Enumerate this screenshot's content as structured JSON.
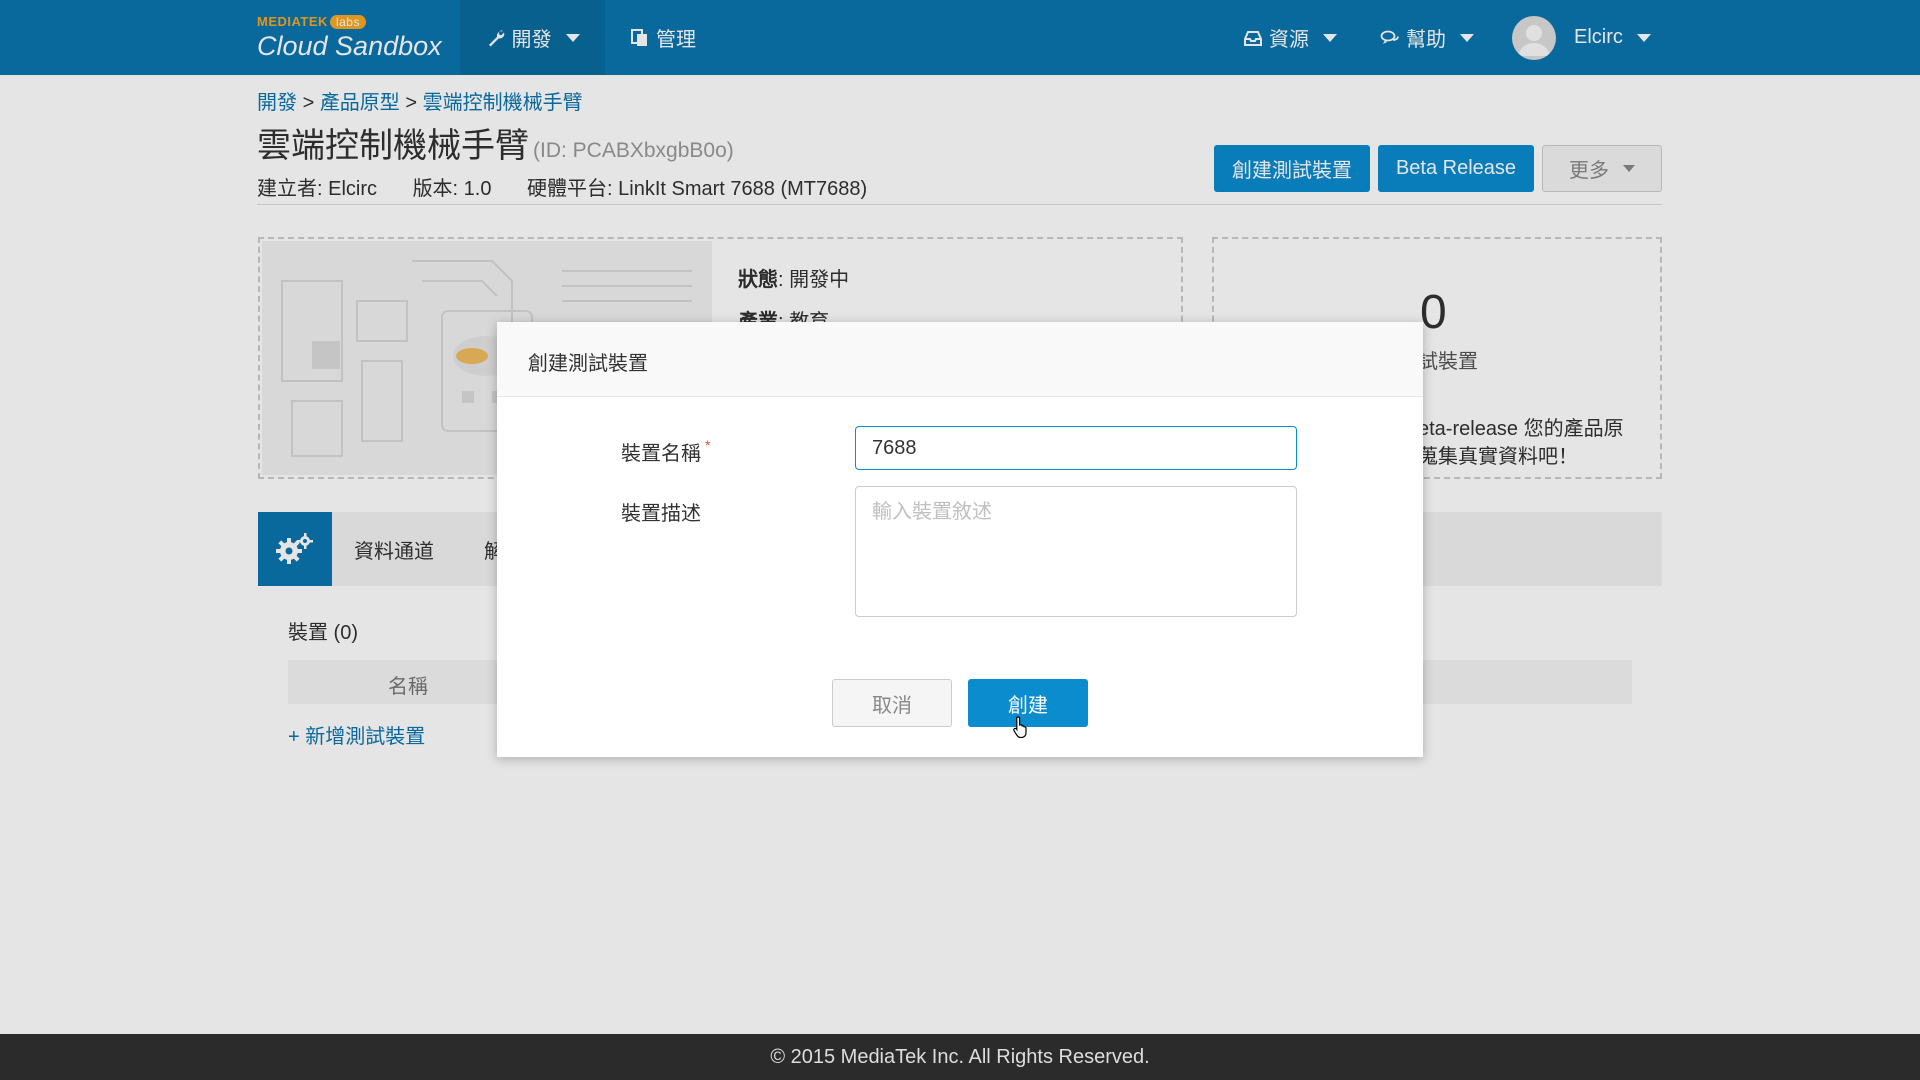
{
  "navbar": {
    "logo_brand": "MEDIATEK",
    "logo_labs": "labs",
    "logo_name": "Cloud Sandbox",
    "dev_label": "開發",
    "manage_label": "管理",
    "resources_label": "資源",
    "help_label": "幫助",
    "user_name": "Elcirc"
  },
  "breadcrumb": {
    "item1": "開發",
    "sep": ">",
    "item2": "產品原型",
    "item3": "雲端控制機械手臂"
  },
  "project": {
    "title": "雲端控制機械手臂",
    "id_text": "(ID: PCABXbxgbB0o)",
    "creator": "建立者: Elcirc",
    "version": "版本: 1.0",
    "platform": "硬體平台: LinkIt Smart 7688 (MT7688)"
  },
  "actions": {
    "create_test_device": "創建測試裝置",
    "beta_release": "Beta Release",
    "more": "更多"
  },
  "info": {
    "status_key": "狀態",
    "status_value": ": 開發中",
    "industry_key": "產業",
    "industry_value": ": 教育"
  },
  "stats": {
    "count": "0",
    "count_label": "試裝置",
    "beta_line1": "eta-release 您的產品原",
    "beta_line2": "蒐集真實資料吧！"
  },
  "tabs": {
    "data_channel": "資料通道",
    "second_partial": "解"
  },
  "devices": {
    "title": "裝置 (0)",
    "column_name": "名稱",
    "add_link": "+ 新增測試裝置"
  },
  "footer": {
    "copyright": "© 2015 MediaTek Inc. All Rights Reserved."
  },
  "modal": {
    "title": "創建測試裝置",
    "name_label": "裝置名稱",
    "required_mark": "*",
    "name_value": "7688",
    "desc_label": "裝置描述",
    "desc_placeholder": "輸入裝置敘述",
    "cancel": "取消",
    "create": "創建"
  },
  "colors": {
    "primary": "#0b75ae",
    "button": "#0b8ccf",
    "accent_logo": "#f7a823",
    "footer": "#2b2b2b"
  },
  "icons": [
    "wrench-icon",
    "copy-icon",
    "inbox-icon",
    "chat-icon",
    "gears-icon",
    "cursor-icon"
  ]
}
